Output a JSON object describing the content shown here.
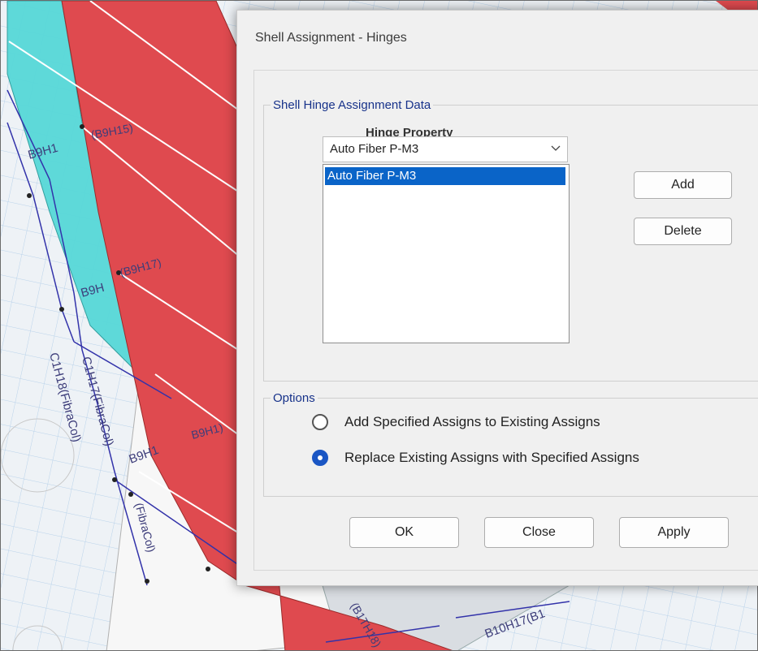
{
  "dialog": {
    "title": "Shell Assignment - Hinges",
    "hinge_group": {
      "legend": "Shell Hinge Assignment Data",
      "property_label": "Hinge Property",
      "selected": "Auto Fiber P-M3",
      "list_items": [
        "Auto  Fiber P-M3"
      ],
      "add_label": "Add",
      "delete_label": "Delete"
    },
    "options_group": {
      "legend": "Options",
      "items": [
        {
          "label": "Add Specified Assigns to Existing Assigns",
          "selected": false
        },
        {
          "label": "Replace Existing Assigns with Specified Assigns",
          "selected": true
        }
      ]
    },
    "buttons": {
      "ok": "OK",
      "close": "Close",
      "apply": "Apply"
    }
  },
  "model_view": {
    "labels": [
      "(B9H15)",
      "B9H1",
      "(B9H17)",
      "B9H",
      "C1H18(FibraCol)",
      "C1H17(FibraCol)",
      "B9H1",
      "B9H1)",
      "(FibraCol)",
      "B10H17(B1",
      "(B1TH18)"
    ],
    "colors": {
      "red_wall": "#df4a4f",
      "cyan_wall": "#57d8d8",
      "grid": "#b9d2ea",
      "frame": "#3333aa"
    }
  }
}
